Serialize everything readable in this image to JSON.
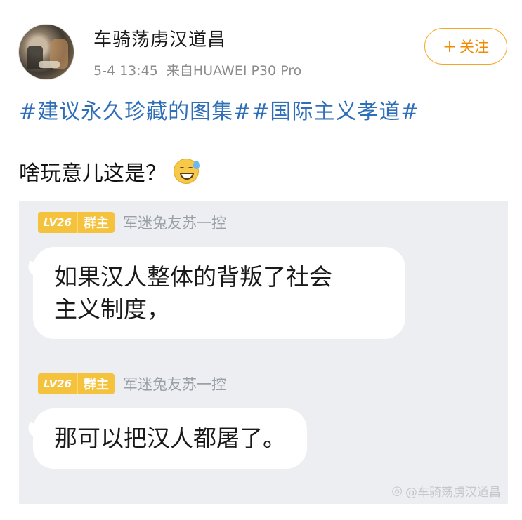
{
  "post": {
    "username": "车骑荡虏汉道昌",
    "date_time": "5-4 13:45",
    "source": "来自HUAWEI P30 Pro",
    "follow_label": "关注",
    "hashtags": "#建议永久珍藏的图集##国际主义孝道#",
    "text": "啥玩意儿这是？",
    "emoji": "grinning-face-with-sweat"
  },
  "chat": {
    "messages": [
      {
        "level": "LV26",
        "role": "群主",
        "sender": "军迷兔友苏一控",
        "text_line1": "如果汉人整体的背叛了社会",
        "text_line2": "主义制度，"
      },
      {
        "level": "LV26",
        "role": "群主",
        "sender": "军迷兔友苏一控",
        "text_line1": "那可以把汉人都屠了。"
      }
    ],
    "watermark": "@车骑荡虏汉道昌"
  },
  "colors": {
    "hashtag": "#2f6fb8",
    "follow": "#f08a00",
    "badge": "#f4c23d",
    "chat_bg": "#edeef1"
  }
}
